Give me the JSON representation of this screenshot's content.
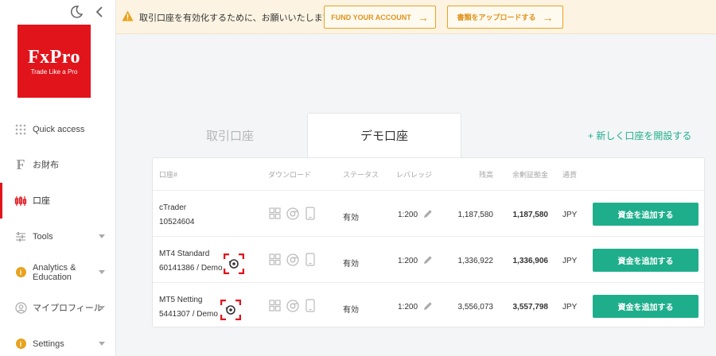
{
  "brand": {
    "name": "FxPro",
    "tagline": "Trade Like a Pro",
    "color": "#e1141c"
  },
  "sidebar": {
    "items": [
      {
        "label": "Quick access",
        "icon": "grid-icon",
        "chevron": false
      },
      {
        "label": "お財布",
        "icon": "wallet-f-icon",
        "chevron": false
      },
      {
        "label": "口座",
        "icon": "candles-icon",
        "chevron": false,
        "active": true
      },
      {
        "label": "Tools",
        "icon": "sliders-icon",
        "chevron": true
      },
      {
        "label": "Analytics & Education",
        "icon": "info-icon",
        "chevron": true
      },
      {
        "label": "マイプロフィール",
        "icon": "user-icon",
        "chevron": true
      },
      {
        "label": "Settings",
        "icon": "info-icon",
        "chevron": true
      }
    ]
  },
  "notice": {
    "text": "取引口座を有効化するために、お願いいたします",
    "fund_button": "FUND YOUR ACCOUNT",
    "upload_button": "書類をアップロードする",
    "accent": "#e8a21d"
  },
  "tabs": {
    "real": "取引口座",
    "demo": "デモ口座",
    "open_account": "+ 新しく口座を開設する"
  },
  "table": {
    "headers": {
      "account": "口座#",
      "download": "ダウンロード",
      "status": "ステータス",
      "leverage": "レバレッジ",
      "balance": "残高",
      "margin": "余剰証拠金",
      "currency": "通貨"
    },
    "rows": [
      {
        "name": "cTrader",
        "number": "10524604",
        "status": "有効",
        "leverage": "1:200",
        "balance": "1,187,580",
        "margin": "1,187,580",
        "currency": "JPY",
        "button": "資金を追加する"
      },
      {
        "name": "MT4 Standard",
        "number": "60141386 / Demo",
        "status": "有効",
        "leverage": "1:200",
        "balance": "1,336,922",
        "margin": "1,336,906",
        "currency": "JPY",
        "button": "資金を追加する"
      },
      {
        "name": "MT5 Netting",
        "number": "5441307 / Demo",
        "status": "有効",
        "leverage": "1:200",
        "balance": "3,556,073",
        "margin": "3,557,798",
        "currency": "JPY",
        "button": "資金を追加する"
      }
    ],
    "accent": "#1fae8c"
  }
}
